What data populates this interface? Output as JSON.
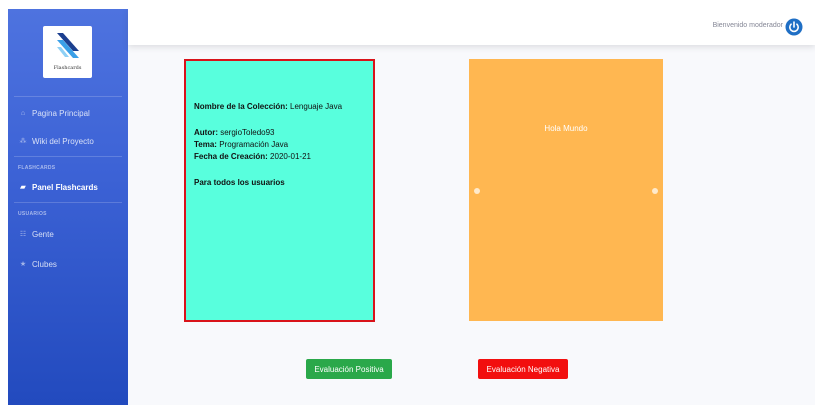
{
  "brand": {
    "label": "Flashcards"
  },
  "sidebar": {
    "items": [
      {
        "label": "Pagina Principal",
        "icon": "home-icon"
      },
      {
        "label": "Wiki del Proyecto",
        "icon": "sitemap-icon"
      }
    ],
    "flashcards_heading": "FLASHCARDS",
    "flashcards_items": [
      {
        "label": "Panel Flashcards",
        "icon": "cards-icon",
        "active": true
      }
    ],
    "users_heading": "USUARIOS",
    "users_items": [
      {
        "label": "Gente",
        "icon": "people-icon"
      },
      {
        "label": "Clubes",
        "icon": "star-icon"
      }
    ]
  },
  "topbar": {
    "welcome": "Bienvenido moderador",
    "power_color": "#1f6fc5"
  },
  "card_front": {
    "collection_label": "Nombre de la Colección:",
    "collection_value": "Lenguaje Java",
    "author_label": "Autor:",
    "author_value": "sergioToledo93",
    "topic_label": "Tema:",
    "topic_value": "Programación Java",
    "date_label": "Fecha de Creación:",
    "date_value": "2020-01-21",
    "audience": "Para todos los usuarios",
    "color": "#58ffdd",
    "border_color": "#d9131a"
  },
  "card_back": {
    "text": "Hola Mundo",
    "color": "#ffb751"
  },
  "actions": {
    "positive": "Evaluación Positiva",
    "negative": "Evaluación Negativa",
    "positive_color": "#2aa84a",
    "negative_color": "#f20f0f"
  }
}
